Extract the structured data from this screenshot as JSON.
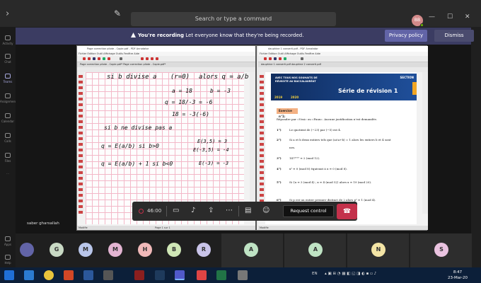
{
  "titlebar": {
    "search_placeholder": "Search or type a command",
    "user_initials": "BB",
    "minimize": "—",
    "maximize": "☐",
    "close": "✕"
  },
  "rail": {
    "items": [
      "Activity",
      "Chat",
      "Teams",
      "Assignments",
      "Calendar",
      "Calls",
      "Files",
      "...",
      "Apps",
      "Help"
    ]
  },
  "banner": {
    "recording_bold": "You're recording",
    "recording_text": "Let everyone know that they're being recorded.",
    "privacy_label": "Privacy policy",
    "dismiss_label": "Dismiss"
  },
  "shared_screen": {
    "left_window": {
      "title": "Page correction pilote - Copie.pdf - PDF Annotator",
      "menu": "Fichier  Edition  Outil  Affichage  Outils  Fenêtre  Aide",
      "tabs": "Page correction pilote - Copie.pdf*     Page correction pilote - Copie.pdf*",
      "status": "Modifie",
      "page_indicator": "Page 1 sur 1",
      "handwriting": [
        "si  b  divise  a",
        "(r=0)",
        "alors  q = a/b",
        "a = 18",
        "b = -3",
        "q = 18/-3 = -6",
        "18 = -3(-6)",
        "si  b  ne  divise  pas  a",
        "q = E(a/b)  si  b>0",
        "E(3,5) = 3",
        "E(-3,5) = -4",
        "q = E(a/b) + 1  si  b<0",
        "E(-3) = -3"
      ]
    },
    "right_window": {
      "title": "dauphine 1 converti.pdf - PDF Annotator",
      "menu": "Fichier  Edition  Outil  Affichage  Outils  Fenêtre  Aide",
      "tabs": "dauphine 1 converti.pdf     dauphine 2 converti.pdf",
      "status": "Modifie",
      "header_small": "AVEC TOUS NOS SOUHAITS DE RÉUSSITE AU BACCALAURÉAT",
      "header_section": "SECTION",
      "year_start": "2019",
      "year_end": "2020",
      "doc_title": "Série de révision 1",
      "exercise_label": "Exercice n°1:",
      "instruction": "Répondre par «Vrai» ou «Faux». Aucune justification n'est demandée.",
      "items": [
        {
          "n": "1°)",
          "text": "Le quotient de (−23) par (−5) est 4."
        },
        {
          "n": "2°)",
          "text": "Si a et b deux entiers tels que (a∧a+b) = 1 alors les entiers b et 4 sont"
        },
        {
          "n": "",
          "text": "nes."
        },
        {
          "n": "3°)",
          "text": "147²⁰¹⁹ ≡ 2 (mod 12)."
        },
        {
          "n": "4°)",
          "text": "x² ≡ 0 (mod 8) équivaut à x ≡ 0 (mod 8)."
        },
        {
          "n": "5°)",
          "text": "Si  {x ≡ 3 (mod 4) ; x ≡ 4 (mod 5)}   alors  x ≡ 19 (mod 20)."
        },
        {
          "n": "6°)",
          "text": "Si p est un entier premier distinct de 2 alors p² ≡ 1 (mod 4)."
        }
      ]
    }
  },
  "call_controls": {
    "timer": "46:00",
    "request_control": "Request control"
  },
  "presenter": "saber gharsallah",
  "participants": [
    "G",
    "M",
    "M",
    "H",
    "B",
    "R",
    "A",
    "A",
    "N",
    "S"
  ],
  "taskbar": {
    "language": "EN",
    "time": "8:47",
    "date": "23-Mar-20"
  },
  "colors": {
    "accent": "#6264a7",
    "banner": "#3b3c62",
    "hangup": "#c4314b"
  }
}
